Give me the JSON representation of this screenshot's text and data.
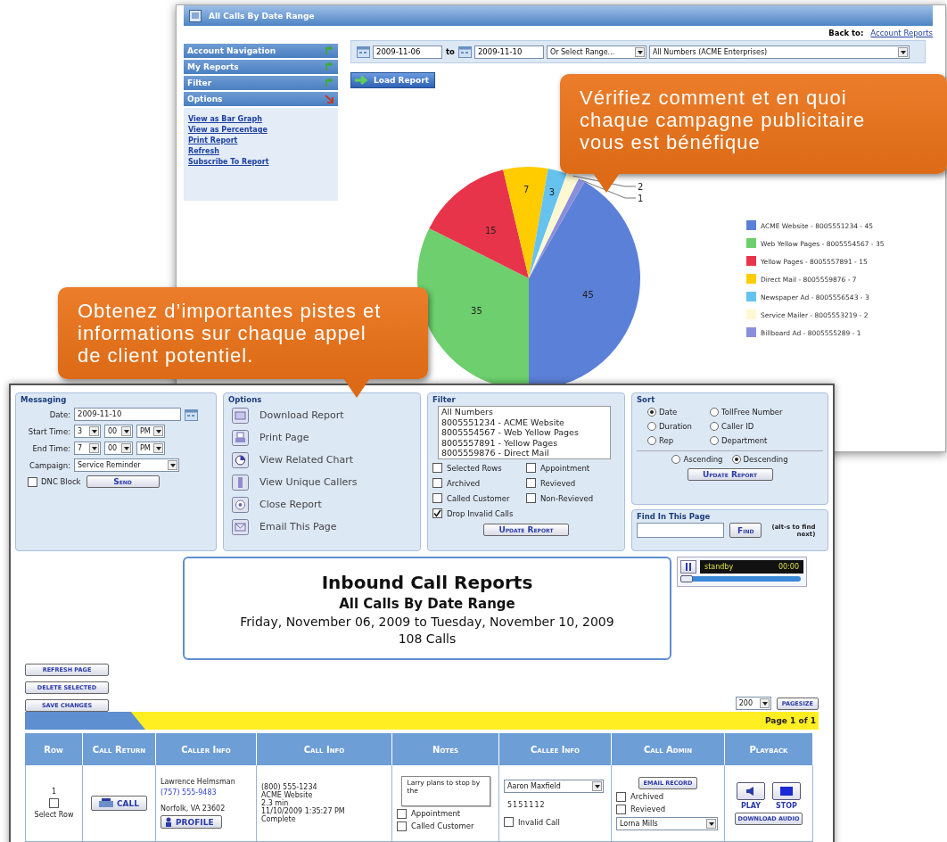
{
  "back_window": {
    "title": "All Calls By Date Range",
    "back_to_label": "Back to:",
    "back_to_link": "Account Reports",
    "sidebar": [
      {
        "label": "Account Navigation",
        "expanded": false
      },
      {
        "label": "My Reports",
        "expanded": false
      },
      {
        "label": "Filter",
        "expanded": false
      },
      {
        "label": "Options",
        "expanded": true
      }
    ],
    "option_links": [
      "View as Bar Graph",
      "View as Percentage",
      "Print Report",
      "Refresh",
      "Subscribe To Report"
    ],
    "date_from": "2009-11-06",
    "to_label": "to",
    "date_to": "2009-11-10",
    "range_select": "Or Select Range...",
    "numbers_select": "All Numbers (ACME Enterprises)",
    "load_button": "Load Report",
    "chart_data": {
      "type": "pie",
      "categories": [
        "ACME Website - 8005551234 - 45",
        "Web Yellow Pages - 8005554567 - 35",
        "Yellow Pages - 8005557891 - 15",
        "Direct Mail - 8005559876 - 7",
        "Newspaper Ad - 8005556543 - 3",
        "Service Mailer - 8005553219 - 2",
        "Billboard Ad - 8005555289 - 1"
      ],
      "series": [
        {
          "values": [
            45,
            35,
            15,
            7,
            3,
            2,
            1
          ],
          "colors": [
            "#5b80d8",
            "#6dcf6d",
            "#e8344a",
            "#ffcc00",
            "#66c2ee",
            "#fdf8d2",
            "#8a8fdc"
          ]
        }
      ],
      "data_labels": true,
      "legend": "right"
    }
  },
  "callouts": [
    {
      "text": "Vérifiez comment et en quoi chaque campagne publicitaire vous est bénéfique"
    },
    {
      "text": "Obtenez d’importantes pistes et informations sur chaque appel de client potentiel."
    }
  ],
  "front_window": {
    "messaging": {
      "title": "Messaging",
      "date_label": "Date:",
      "date": "2009-11-10",
      "start_label": "Start Time:",
      "start": [
        "3",
        "00",
        "PM"
      ],
      "end_label": "End Time:",
      "end": [
        "7",
        "00",
        "PM"
      ],
      "campaign_label": "Campaign:",
      "campaign": "Service Reminder",
      "dnc_label": "DNC Block",
      "dnc_checked": false,
      "send_button": "Send"
    },
    "options": {
      "title": "Options",
      "items": [
        "Download Report",
        "Print Page",
        "View Related Chart",
        "View Unique Callers",
        "Close Report",
        "Email This Page"
      ]
    },
    "filter": {
      "title": "Filter",
      "numbers": [
        "All Numbers",
        "8005551234 - ACME Website",
        "8005554567 - Web Yellow Pages",
        "8005557891 - Yellow Pages",
        "8005559876 - Direct Mail"
      ],
      "checkboxes": [
        {
          "label": "Selected Rows",
          "checked": false
        },
        {
          "label": "Appointment",
          "checked": false
        },
        {
          "label": "Archived",
          "checked": false
        },
        {
          "label": "Revieved",
          "checked": false
        },
        {
          "label": "Called Customer",
          "checked": false
        },
        {
          "label": "Non-Revieved",
          "checked": false
        },
        {
          "label": "Drop Invalid Calls",
          "checked": true
        }
      ],
      "update_button": "Update Report"
    },
    "sort": {
      "title": "Sort",
      "fields": [
        {
          "label": "Date",
          "selected": true
        },
        {
          "label": "TollFree Number",
          "selected": false
        },
        {
          "label": "Duration",
          "selected": false
        },
        {
          "label": "Caller ID",
          "selected": false
        },
        {
          "label": "Rep",
          "selected": false
        },
        {
          "label": "Department",
          "selected": false
        }
      ],
      "order": [
        {
          "label": "Ascending",
          "selected": false
        },
        {
          "label": "Descending",
          "selected": true
        }
      ],
      "update_button": "Update Report"
    },
    "find": {
      "title": "Find In This Page",
      "button": "Find",
      "hint": "(alt-s to find next)"
    },
    "report": {
      "title": "Inbound Call Reports",
      "subtitle": "All Calls By Date Range",
      "range": "Friday, November 06, 2009 to Tuesday, November 10, 2009",
      "count": "108 Calls"
    },
    "player": {
      "status": "standby",
      "time": "00:00",
      "level": 0
    },
    "action_buttons": [
      "REFRESH PAGE",
      "DELETE SELECTED",
      "SAVE CHANGES"
    ],
    "page_size": "200",
    "page_size_button": "PAGESIZE",
    "page_label": "Page 1 of 1",
    "columns": [
      "Row",
      "Call Return",
      "Caller Info",
      "Call Info",
      "Notes",
      "Callee Info",
      "Call Admin",
      "Playback"
    ],
    "rows": [
      {
        "row": "1",
        "select_label": "Select Row",
        "selected": false,
        "call_button": "CALL",
        "caller_name": "Lawrence Helmsman",
        "caller_phone": "(757) 555-9483",
        "caller_location": "Norfolk, VA 23602",
        "profile_button": "PROFILE",
        "call_info": [
          "(800) 555-1234",
          "ACME Website",
          "2.3 min",
          "11/10/2009 1:35:27 PM",
          "Complete"
        ],
        "note": "Larry plans to stop by the",
        "flags": [
          {
            "label": "Appointment",
            "checked": false
          },
          {
            "label": "Called Customer",
            "checked": false
          }
        ],
        "callee": "Aaron Maxfield",
        "extension": "5151112",
        "invalid_label": "Invalid Call",
        "invalid": false,
        "email_button": "EMAIL RECORD",
        "admin_flags": [
          {
            "label": "Archived",
            "checked": false
          },
          {
            "label": "Revieved",
            "checked": false
          }
        ],
        "rep": "Lorna Mills",
        "play_label": "PLAY",
        "stop_label": "STOP",
        "download_button": "DOWNLOAD AUDIO"
      }
    ]
  }
}
